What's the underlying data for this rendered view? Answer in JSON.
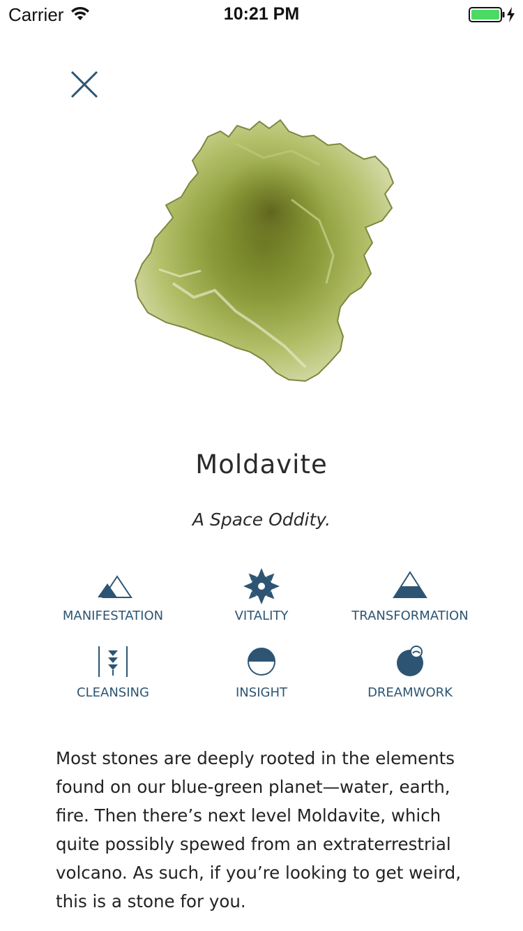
{
  "status_bar": {
    "carrier": "Carrier",
    "time": "10:21 PM",
    "battery_color": "#4cd964"
  },
  "stone": {
    "name": "Moldavite",
    "tagline": "A Space Oddity.",
    "image_icon": "moldavite-stone-image"
  },
  "properties": [
    {
      "label": "MANIFESTATION",
      "icon": "mountains-icon"
    },
    {
      "label": "VITALITY",
      "icon": "sun-icon"
    },
    {
      "label": "TRANSFORMATION",
      "icon": "triangle-icon"
    },
    {
      "label": "CLEANSING",
      "icon": "downward-arrows-icon"
    },
    {
      "label": "INSIGHT",
      "icon": "half-circle-icon"
    },
    {
      "label": "DREAMWORK",
      "icon": "moon-orb-icon"
    }
  ],
  "description": "Most stones are deeply rooted in the elements found on our blue-green planet—water, earth, fire. Then there’s next level Moldavite, which quite possibly spewed from an extraterrestrial volcano. As such, if you’re looking to get weird, this is a stone for you.",
  "colors": {
    "accent": "#2d5573",
    "text": "#222222",
    "background": "#ffffff"
  }
}
